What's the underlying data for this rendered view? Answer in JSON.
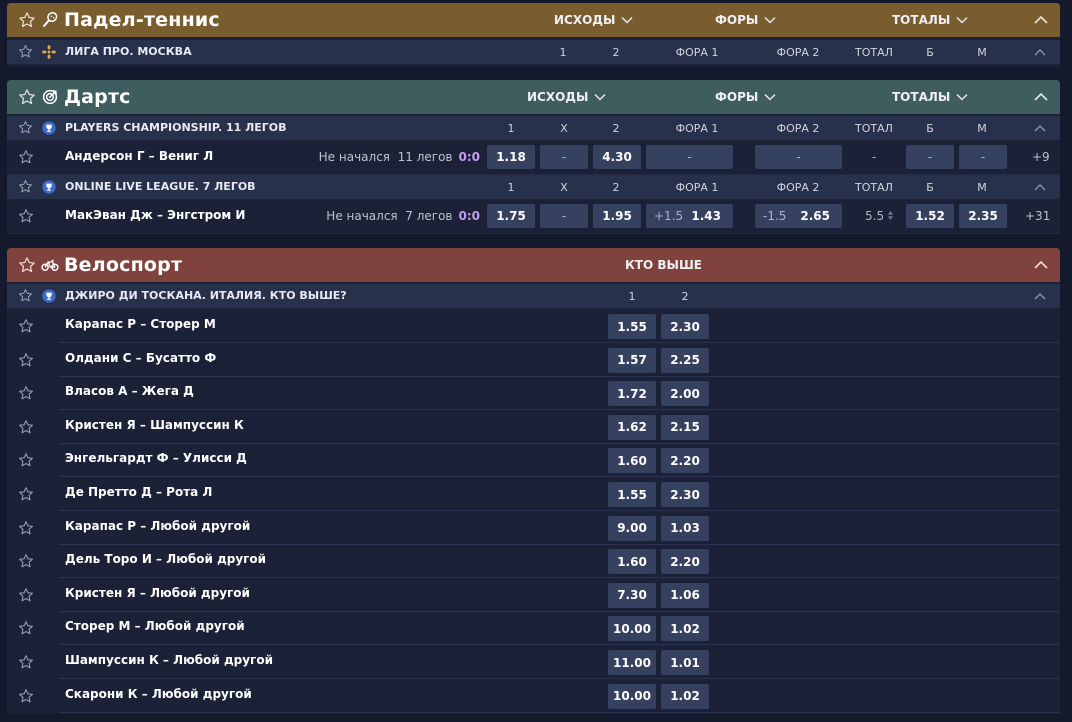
{
  "padel": {
    "title": "Падел-теннис",
    "headers": [
      "ИСХОДЫ",
      "ФОРЫ",
      "ТОТАЛЫ"
    ],
    "league": {
      "name": "ЛИГА ПРО. МОСКВА",
      "columns": [
        "1",
        "2",
        "ФОРА 1",
        "ФОРА 2",
        "ТОТАЛ",
        "Б",
        "М"
      ]
    }
  },
  "darts": {
    "title": "Дартс",
    "headers": [
      "ИСХОДЫ",
      "ФОРЫ",
      "ТОТАЛЫ"
    ],
    "leagues": [
      {
        "name": "PLAYERS CHAMPIONSHIP. 11 ЛЕГОВ",
        "columns": [
          "1",
          "X",
          "2",
          "ФОРА 1",
          "ФОРА 2",
          "ТОТАЛ",
          "Б",
          "М"
        ],
        "event": {
          "name": "Андерсон Г – Вениг Л",
          "status": "Не начался  11 легов",
          "score": "0:0",
          "odd1": "1.18",
          "oddX": "-",
          "odd2": "4.30",
          "fora1": "-",
          "fora2": "-",
          "total": "-",
          "over": "-",
          "under": "-",
          "more": "+9"
        }
      },
      {
        "name": "ONLINE LIVE LEAGUE. 7 ЛЕГОВ",
        "columns": [
          "1",
          "X",
          "2",
          "ФОРА 1",
          "ФОРА 2",
          "ТОТАЛ",
          "Б",
          "М"
        ],
        "event": {
          "name": "МакЭван Дж – Энгстром И",
          "status": "Не начался  7 легов",
          "score": "0:0",
          "odd1": "1.75",
          "oddX": "-",
          "odd2": "1.95",
          "fora1_hc": "+1.5",
          "fora1": "1.43",
          "fora2_hc": "-1.5",
          "fora2": "2.65",
          "total": "5.5",
          "over": "1.52",
          "under": "2.35",
          "more": "+31"
        }
      }
    ]
  },
  "cycling": {
    "title": "Велоспорт",
    "header": "КТО ВЫШЕ",
    "league": {
      "name": "ДЖИРО ДИ ТОСКАНА. ИТАЛИЯ. КТО ВЫШЕ?",
      "columns": [
        "1",
        "2"
      ]
    },
    "events": [
      {
        "name": "Карапас Р – Сторер М",
        "odd1": "1.55",
        "odd2": "2.30"
      },
      {
        "name": "Олдани С – Бусатто Ф",
        "odd1": "1.57",
        "odd2": "2.25"
      },
      {
        "name": "Власов А – Жега Д",
        "odd1": "1.72",
        "odd2": "2.00"
      },
      {
        "name": "Кристен Я – Шампуссин К",
        "odd1": "1.62",
        "odd2": "2.15"
      },
      {
        "name": "Энгельгардт Ф – Улисси Д",
        "odd1": "1.60",
        "odd2": "2.20"
      },
      {
        "name": "Де Претто Д – Рота Л",
        "odd1": "1.55",
        "odd2": "2.30"
      },
      {
        "name": "Карапас Р – Любой другой",
        "odd1": "9.00",
        "odd2": "1.03"
      },
      {
        "name": "Дель Торо И – Любой другой",
        "odd1": "1.60",
        "odd2": "2.20"
      },
      {
        "name": "Кристен Я – Любой другой",
        "odd1": "7.30",
        "odd2": "1.06"
      },
      {
        "name": "Сторер М – Любой другой",
        "odd1": "10.00",
        "odd2": "1.02"
      },
      {
        "name": "Шампуссин К – Любой другой",
        "odd1": "11.00",
        "odd2": "1.01"
      },
      {
        "name": "Скарони К – Любой другой",
        "odd1": "10.00",
        "odd2": "1.02"
      }
    ]
  }
}
